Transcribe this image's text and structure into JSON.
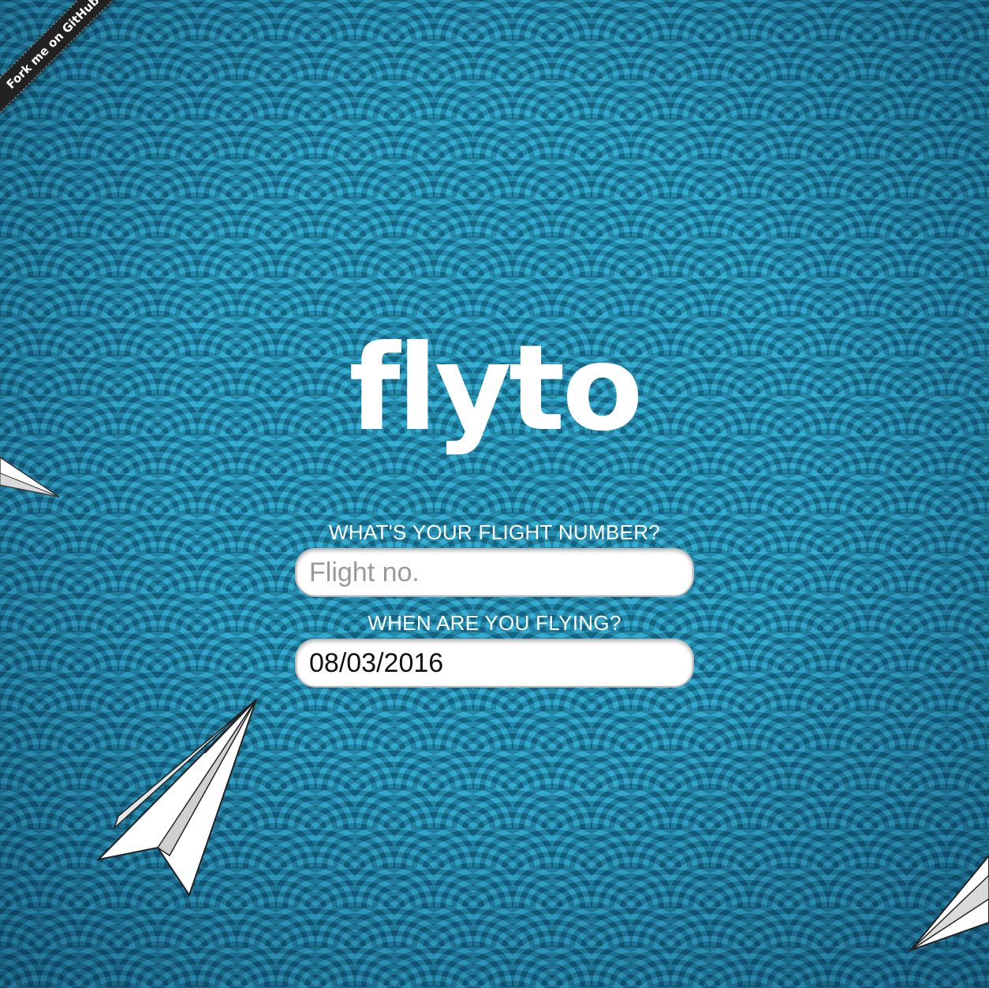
{
  "ribbon": {
    "label": "Fork me on GitHub"
  },
  "logo": {
    "text": "FLYTO"
  },
  "form": {
    "flight_label": "WHAT'S YOUR FLIGHT NUMBER?",
    "flight_placeholder": "Flight no.",
    "flight_value": "",
    "date_label": "WHEN ARE YOU FLYING?",
    "date_value": "08/03/2016"
  },
  "decorations": [
    "paper-plane-icon",
    "paper-plane-icon",
    "paper-plane-icon"
  ],
  "colors": {
    "background": "#1a7e9f",
    "text": "#ffffff",
    "field_border": "#b9b9b9"
  }
}
